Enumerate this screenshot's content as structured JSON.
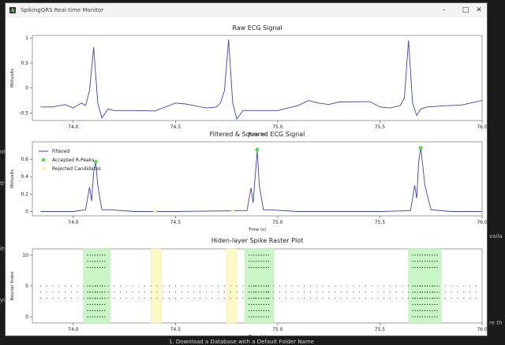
{
  "window": {
    "title": "SpikingQRS Real-time Monitor",
    "icon": "app-logo-icon",
    "controls": [
      "minimize-icon",
      "maximize-icon",
      "close-icon"
    ]
  },
  "background_fragments": [
    {
      "id": "frag-1",
      "text": "ot",
      "y": 189
    },
    {
      "id": "frag-2",
      "text": "the",
      "y": 229
    },
    {
      "id": "frag-3",
      "text": "ity",
      "y": 312
    },
    {
      "id": "frag-4",
      "text": "yo",
      "y": 377
    }
  ],
  "background_fragments_right": [
    {
      "id": "frag-r1",
      "text": "vaila",
      "y": 296
    },
    {
      "id": "frag-r2",
      "text": "re th",
      "y": 406
    }
  ],
  "bottom_caption": "1. Download a Database with a Default Folder Name",
  "chart_data": [
    {
      "type": "line",
      "title": "Raw ECG Signal",
      "xlabel": "Time (s)",
      "ylabel": "Millivolts",
      "xlim": [
        73.8,
        76.0
      ],
      "ylim": [
        -0.65,
        1.05
      ],
      "xticks": [
        "74.0",
        "74.5",
        "75.0",
        "75.5",
        "76.0"
      ],
      "yticks": [
        "-0.5",
        "0",
        "0.5",
        "1"
      ],
      "series": [
        {
          "color": "#3f3fbf",
          "x": [
            73.84,
            73.9,
            73.96,
            74.0,
            74.04,
            74.06,
            74.08,
            74.1,
            74.12,
            74.14,
            74.17,
            74.2,
            74.3,
            74.4,
            74.5,
            74.55,
            74.6,
            74.65,
            74.7,
            74.72,
            74.74,
            74.76,
            74.78,
            74.8,
            74.83,
            74.9,
            75.0,
            75.1,
            75.15,
            75.2,
            75.25,
            75.3,
            75.45,
            75.5,
            75.55,
            75.6,
            75.62,
            75.64,
            75.66,
            75.68,
            75.7,
            75.73,
            75.8,
            75.9,
            76.0
          ],
          "y": [
            -0.38,
            -0.38,
            -0.33,
            -0.4,
            -0.3,
            -0.35,
            -0.05,
            0.82,
            -0.3,
            -0.6,
            -0.42,
            -0.45,
            -0.45,
            -0.46,
            -0.3,
            -0.32,
            -0.36,
            -0.4,
            -0.38,
            -0.3,
            -0.05,
            0.97,
            -0.3,
            -0.62,
            -0.45,
            -0.45,
            -0.45,
            -0.35,
            -0.25,
            -0.3,
            -0.33,
            -0.28,
            -0.27,
            -0.38,
            -0.4,
            -0.35,
            -0.2,
            0.95,
            -0.3,
            -0.55,
            -0.42,
            -0.38,
            -0.36,
            -0.34,
            -0.25
          ]
        }
      ]
    },
    {
      "type": "line",
      "title": "Filtered & Squared ECG Signal",
      "xlabel": "Time (s)",
      "ylabel": "Millivolts",
      "xlim": [
        73.8,
        76.0
      ],
      "ylim": [
        -0.05,
        0.8
      ],
      "xticks": [
        "74.0",
        "74.5",
        "75.0",
        "75.5",
        "76.0"
      ],
      "yticks": [
        "0",
        "0.2",
        "0.4",
        "0.6"
      ],
      "legend": {
        "placement": "top-left",
        "entries": [
          "Filtered",
          "Accepted R-Peaks",
          "Rejected Candidates"
        ]
      },
      "series": [
        {
          "name": "Filtered",
          "color": "#3f3fbf",
          "x": [
            73.84,
            74.0,
            74.06,
            74.08,
            74.09,
            74.1,
            74.11,
            74.12,
            74.14,
            74.18,
            74.3,
            74.5,
            74.85,
            74.87,
            74.88,
            74.9,
            74.91,
            74.93,
            74.96,
            75.1,
            75.5,
            75.65,
            75.67,
            75.68,
            75.69,
            75.7,
            75.72,
            75.75,
            75.85,
            76.0
          ],
          "y": [
            0,
            0,
            0.02,
            0.28,
            0.12,
            0.45,
            0.57,
            0.3,
            0.02,
            0.02,
            0,
            0,
            0.01,
            0.27,
            0.1,
            0.7,
            0.3,
            0.02,
            0.02,
            0,
            0,
            0.01,
            0.3,
            0.15,
            0.58,
            0.73,
            0.3,
            0.02,
            0,
            0
          ]
        },
        {
          "name": "Accepted R-Peaks",
          "color": "#44dd44",
          "x": [
            74.11,
            74.9,
            75.7
          ],
          "y": [
            0.57,
            0.71,
            0.73
          ]
        },
        {
          "name": "Rejected Candidates",
          "color": "#f5f5a0",
          "x": [
            74.4,
            74.78
          ],
          "y": [
            0,
            0
          ]
        }
      ]
    },
    {
      "type": "scatter",
      "title": "Hiden-layer Spike Raster Plot",
      "xlabel": "Time (s)",
      "ylabel": "Neuron Index",
      "xlim": [
        73.8,
        76.0
      ],
      "ylim": [
        -1,
        11
      ],
      "xticks": [
        "74.0",
        "74.5",
        "75.0",
        "75.5",
        "76.0"
      ],
      "yticks": [
        "0",
        "5",
        "10"
      ],
      "accepted_regions": [
        [
          74.05,
          74.18
        ],
        [
          74.84,
          74.98
        ],
        [
          75.64,
          75.8
        ]
      ],
      "rejected_regions": [
        [
          74.38,
          74.43
        ],
        [
          74.75,
          74.8
        ]
      ],
      "background_neurons": [
        3,
        4,
        5
      ],
      "background_spacing_s": 0.03,
      "dense_spikes": {
        "x": [
          [
            74.07,
            74.16
          ],
          [
            74.86,
            74.96
          ],
          [
            75.66,
            75.78
          ]
        ],
        "neurons": [
          0,
          1,
          2,
          3,
          4,
          5,
          8,
          9,
          10
        ],
        "spacing_s": 0.012
      }
    }
  ]
}
